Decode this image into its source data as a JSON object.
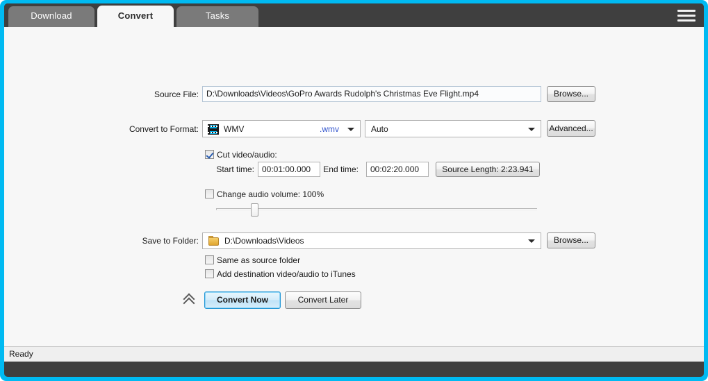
{
  "window": {
    "frame_color": "#00baf2",
    "titlebar_color": "#3f3f3f"
  },
  "tabs": [
    {
      "label": "Download",
      "active": false
    },
    {
      "label": "Convert",
      "active": true
    },
    {
      "label": "Tasks",
      "active": false
    }
  ],
  "menu": {
    "icon": "hamburger-icon"
  },
  "form": {
    "source_file": {
      "label": "Source File:",
      "value": "D:\\Downloads\\Videos\\GoPro Awards  Rudolph's Christmas Eve Flight.mp4",
      "browse_label": "Browse..."
    },
    "format": {
      "label": "Convert to Format:",
      "icon": "film-strip-icon",
      "value": "WMV",
      "extension": ".wmv",
      "extension_color": "#3355cc",
      "profile_value": "Auto",
      "advanced_label": "Advanced..."
    },
    "cut": {
      "label": "Cut video/audio:",
      "checked": true,
      "start_label": "Start time:",
      "start_value": "00:01:00.000",
      "end_label": "End time:",
      "end_value": "00:02:20.000",
      "source_length_label": "Source Length: 2:23.941"
    },
    "volume": {
      "label": "Change audio volume: 100%",
      "checked": false,
      "percent": 100,
      "slider_position_pct": 11
    },
    "save_folder": {
      "label": "Save to Folder:",
      "icon": "folder-icon",
      "value": "D:\\Downloads\\Videos",
      "browse_label": "Browse..."
    },
    "same_as_source": {
      "label": "Same as source folder",
      "checked": false
    },
    "add_to_itunes": {
      "label": "Add destination video/audio to iTunes",
      "checked": false
    },
    "actions": {
      "collapse_icon": "double-chevron-up-icon",
      "convert_now_label": "Convert Now",
      "convert_later_label": "Convert Later"
    }
  },
  "statusbar": {
    "text": "Ready"
  }
}
